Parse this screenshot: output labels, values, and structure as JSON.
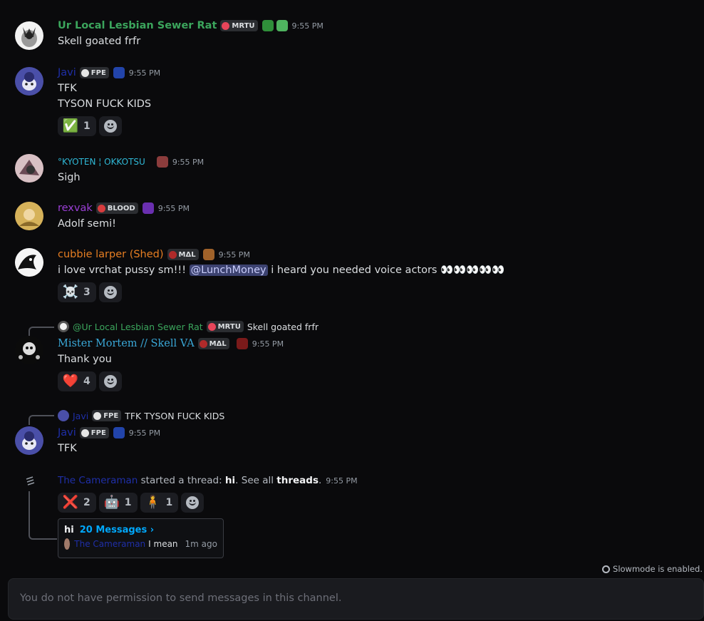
{
  "messages": [
    {
      "author": "Ur Local Lesbian Sewer Rat",
      "author_color": "#3ba55c",
      "tag": "MRTU",
      "tag_icon_color": "#e8455a",
      "role_icons": [
        "frog-icon",
        "frog-icon"
      ],
      "time": "9:55 PM",
      "lines": [
        "Skell goated frfr"
      ]
    },
    {
      "author": "Javi",
      "author_color": "#1f2fa8",
      "tag": "FPE",
      "tag_icon_color": "#e6e6e6",
      "role_icons": [
        "blue-mascot-icon"
      ],
      "time": "9:55 PM",
      "lines": [
        "TFK",
        "TYSON FUCK KIDS"
      ],
      "reactions": [
        {
          "emoji": "✅",
          "count": "1"
        }
      ]
    },
    {
      "author": "°KYOTEN ¦ OKKOTSU",
      "author_color": "#2fb8d6",
      "role_icons": [
        "bear-icon"
      ],
      "time": "9:55 PM",
      "lines": [
        "Sigh"
      ]
    },
    {
      "author": "rexvak",
      "author_color": "#9b3fd6",
      "tag": "BLOOD",
      "tag_icon_color": "#d83c3e",
      "role_icons": [
        "purple-bear-icon"
      ],
      "time": "9:55 PM",
      "lines": [
        "Adolf semi!"
      ]
    },
    {
      "author": "cubbie larper (Shed)",
      "author_color": "#e67e22",
      "tag": "MΔL",
      "tag_icon_color": "#b02a2a",
      "role_icons": [
        "brown-bear-icon"
      ],
      "time": "9:55 PM",
      "line_prefix": "i love vrchat pussy sm!!! ",
      "mention": "@LunchMoney",
      "line_suffix": " i heard you needed voice actors 👀👀👀👀👀",
      "reactions": [
        {
          "emoji": "☠️",
          "count": "3"
        }
      ]
    },
    {
      "reply": {
        "author": "@Ur Local Lesbian Sewer Rat",
        "tag": "MRTU",
        "text": "Skell goated frfr"
      },
      "author": "Mister Mortem // Skell VA",
      "author_color": "#3aa8d8",
      "tag": "MΔL",
      "tag_icon_color": "#b02a2a",
      "role_icons": [
        "red-mascot-icon"
      ],
      "time": "9:55 PM",
      "lines": [
        "Thank you"
      ],
      "reactions": [
        {
          "emoji": "❤️",
          "count": "4"
        }
      ]
    },
    {
      "reply": {
        "author": "Javi",
        "tag": "FPE",
        "text": "TFK TYSON FUCK KIDS"
      },
      "author": "Javi",
      "author_color": "#1f2fa8",
      "tag": "FPE",
      "tag_icon_color": "#e6e6e6",
      "role_icons": [
        "blue-mascot-icon"
      ],
      "time": "9:55 PM",
      "lines": [
        "TFK"
      ]
    }
  ],
  "thread_system": {
    "author": "The Cameraman",
    "text1": " started a thread: ",
    "thread_name": "hi",
    "text2": ". See all ",
    "threads_link": "threads",
    "text3": ".",
    "time": "9:55 PM",
    "reactions": [
      {
        "emoji": "❌",
        "count": "2"
      },
      {
        "emoji": "🤖",
        "count": "1"
      },
      {
        "emoji": "🧍",
        "count": "1"
      }
    ],
    "card": {
      "name": "hi",
      "count_label": "20 Messages ›",
      "last_author": "The Cameraman",
      "last_text": "I mean",
      "last_time": "1m ago"
    }
  },
  "slowmode": "Slowmode is enabled.",
  "composer_placeholder": "You do not have permission to send messages in this channel."
}
